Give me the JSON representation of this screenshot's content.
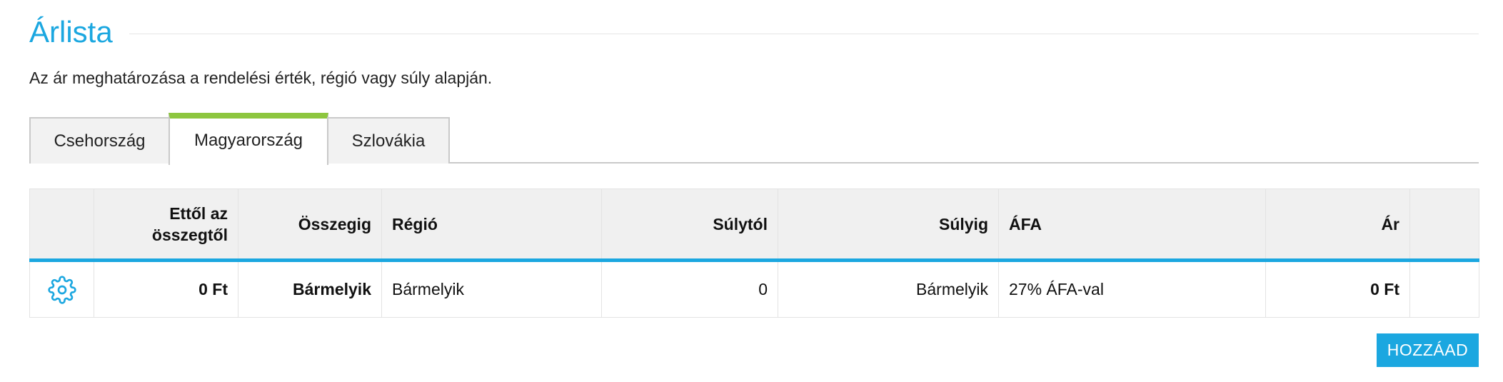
{
  "page": {
    "title": "Árlista",
    "subtitle": "Az ár meghatározása a rendelési érték, régió vagy súly alapján."
  },
  "tabs": [
    {
      "label": "Csehország",
      "active": false
    },
    {
      "label": "Magyarország",
      "active": true
    },
    {
      "label": "Szlovákia",
      "active": false
    }
  ],
  "table": {
    "headers": {
      "from_amount": "Ettől az összegtől",
      "to_amount": "Összegig",
      "region": "Régió",
      "from_weight": "Súlytól",
      "to_weight": "Súlyig",
      "vat": "ÁFA",
      "price": "Ár"
    },
    "rows": [
      {
        "icon": "gear-icon",
        "from_amount": "0 Ft",
        "to_amount": "Bármelyik",
        "region": "Bármelyik",
        "from_weight": "0",
        "to_weight": "Bármelyik",
        "vat": "27% ÁFA-val",
        "price": "0 Ft"
      }
    ]
  },
  "actions": {
    "add_label": "HOZZÁAD"
  },
  "colors": {
    "accent": "#1ba7e0",
    "active_tab": "#8dc63f",
    "header_bg": "#f0f0f0"
  }
}
